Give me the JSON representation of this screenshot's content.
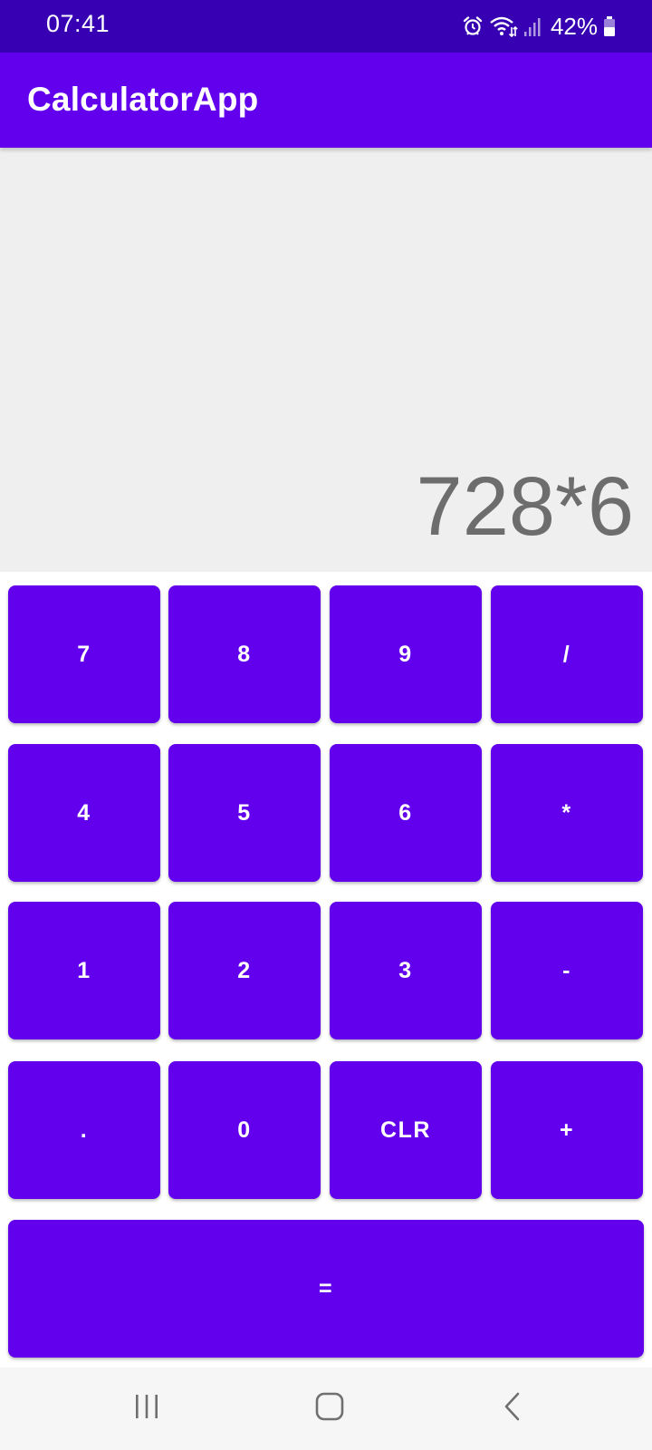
{
  "status_bar": {
    "time": "07:41",
    "battery_percent": "42%",
    "icons": [
      "alarm-icon",
      "wifi-icon",
      "signal-icon",
      "battery-icon"
    ]
  },
  "app_bar": {
    "title": "CalculatorApp"
  },
  "display": {
    "expression": "728*6"
  },
  "keypad": {
    "rows": [
      [
        "7",
        "8",
        "9",
        "/"
      ],
      [
        "4",
        "5",
        "6",
        "*"
      ],
      [
        "1",
        "2",
        "3",
        "-"
      ],
      [
        ".",
        "0",
        "CLR",
        "+"
      ]
    ],
    "equals": "="
  },
  "nav_bar": {
    "icons": [
      "recent-apps-icon",
      "home-icon",
      "back-icon"
    ]
  },
  "colors": {
    "status_bar": "#3700b3",
    "primary": "#6200ee",
    "display_bg": "#efefef",
    "display_text": "#6d6d6d",
    "nav_bar": "#f6f6f6"
  }
}
